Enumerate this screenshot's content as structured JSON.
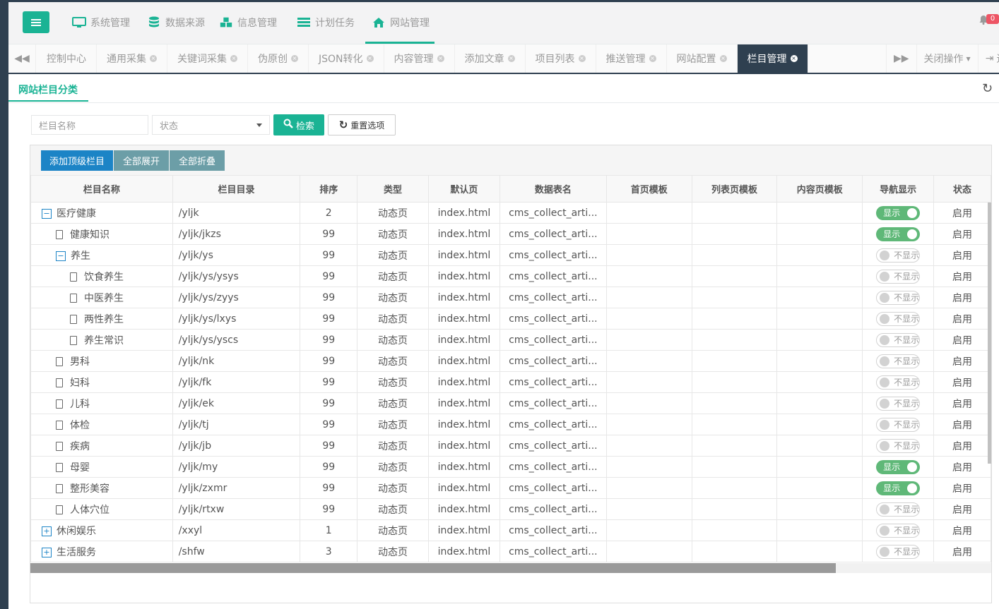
{
  "topnav": {
    "items": [
      {
        "label": "系统管理",
        "icon": "monitor-icon"
      },
      {
        "label": "数据来源",
        "icon": "database-icon"
      },
      {
        "label": "信息管理",
        "icon": "cubes-icon"
      },
      {
        "label": "计划任务",
        "icon": "tasks-icon"
      },
      {
        "label": "网站管理",
        "icon": "home-icon"
      }
    ],
    "active": "网站管理",
    "notification_count": "0"
  },
  "tabs": [
    {
      "label": "控制中心",
      "closable": false
    },
    {
      "label": "通用采集",
      "closable": true
    },
    {
      "label": "关键词采集",
      "closable": true
    },
    {
      "label": "伪原创",
      "closable": true
    },
    {
      "label": "JSON转化",
      "closable": true
    },
    {
      "label": "内容管理",
      "closable": true
    },
    {
      "label": "添加文章",
      "closable": true
    },
    {
      "label": "项目列表",
      "closable": true
    },
    {
      "label": "推送管理",
      "closable": true
    },
    {
      "label": "网站配置",
      "closable": true
    },
    {
      "label": "栏目管理",
      "closable": true,
      "active": true
    }
  ],
  "tab_actions": {
    "close_ops": "关闭操作",
    "exit": "退"
  },
  "page": {
    "title": "网站栏目分类"
  },
  "filters": {
    "name_placeholder": "栏目名称",
    "status_placeholder": "状态",
    "search_label": "检索",
    "reset_label": "重置选项"
  },
  "toolbar": {
    "add_top": "添加顶级栏目",
    "expand_all": "全部展开",
    "collapse_all": "全部折叠"
  },
  "table": {
    "headers": [
      "栏目名称",
      "栏目目录",
      "排序",
      "类型",
      "默认页",
      "数据表名",
      "首页模板",
      "列表页模板",
      "内容页模板",
      "导航显示",
      "状态"
    ],
    "rows": [
      {
        "level": 0,
        "node": "minus",
        "name": "医疗健康",
        "dir": "/yljk",
        "sort": "2",
        "type": "动态页",
        "default": "index.html",
        "table": "cms_collect_arti...",
        "nav": "显示",
        "nav_on": true,
        "status": "启用"
      },
      {
        "level": 1,
        "node": "leaf",
        "name": "健康知识",
        "dir": "/yljk/jkzs",
        "sort": "99",
        "type": "动态页",
        "default": "index.html",
        "table": "cms_collect_arti...",
        "nav": "显示",
        "nav_on": true,
        "status": "启用"
      },
      {
        "level": 1,
        "node": "minus",
        "name": "养生",
        "dir": "/yljk/ys",
        "sort": "99",
        "type": "动态页",
        "default": "index.html",
        "table": "cms_collect_arti...",
        "nav": "不显示",
        "nav_on": false,
        "status": "启用"
      },
      {
        "level": 2,
        "node": "leaf",
        "name": "饮食养生",
        "dir": "/yljk/ys/ysys",
        "sort": "99",
        "type": "动态页",
        "default": "index.html",
        "table": "cms_collect_arti...",
        "nav": "不显示",
        "nav_on": false,
        "status": "启用"
      },
      {
        "level": 2,
        "node": "leaf",
        "name": "中医养生",
        "dir": "/yljk/ys/zyys",
        "sort": "99",
        "type": "动态页",
        "default": "index.html",
        "table": "cms_collect_arti...",
        "nav": "不显示",
        "nav_on": false,
        "status": "启用"
      },
      {
        "level": 2,
        "node": "leaf",
        "name": "两性养生",
        "dir": "/yljk/ys/lxys",
        "sort": "99",
        "type": "动态页",
        "default": "index.html",
        "table": "cms_collect_arti...",
        "nav": "不显示",
        "nav_on": false,
        "status": "启用"
      },
      {
        "level": 2,
        "node": "leaf",
        "name": "养生常识",
        "dir": "/yljk/ys/yscs",
        "sort": "99",
        "type": "动态页",
        "default": "index.html",
        "table": "cms_collect_arti...",
        "nav": "不显示",
        "nav_on": false,
        "status": "启用"
      },
      {
        "level": 1,
        "node": "leaf",
        "name": "男科",
        "dir": "/yljk/nk",
        "sort": "99",
        "type": "动态页",
        "default": "index.html",
        "table": "cms_collect_arti...",
        "nav": "不显示",
        "nav_on": false,
        "status": "启用"
      },
      {
        "level": 1,
        "node": "leaf",
        "name": "妇科",
        "dir": "/yljk/fk",
        "sort": "99",
        "type": "动态页",
        "default": "index.html",
        "table": "cms_collect_arti...",
        "nav": "不显示",
        "nav_on": false,
        "status": "启用"
      },
      {
        "level": 1,
        "node": "leaf",
        "name": "儿科",
        "dir": "/yljk/ek",
        "sort": "99",
        "type": "动态页",
        "default": "index.html",
        "table": "cms_collect_arti...",
        "nav": "不显示",
        "nav_on": false,
        "status": "启用"
      },
      {
        "level": 1,
        "node": "leaf",
        "name": "体检",
        "dir": "/yljk/tj",
        "sort": "99",
        "type": "动态页",
        "default": "index.html",
        "table": "cms_collect_arti...",
        "nav": "不显示",
        "nav_on": false,
        "status": "启用"
      },
      {
        "level": 1,
        "node": "leaf",
        "name": "疾病",
        "dir": "/yljk/jb",
        "sort": "99",
        "type": "动态页",
        "default": "index.html",
        "table": "cms_collect_arti...",
        "nav": "不显示",
        "nav_on": false,
        "status": "启用"
      },
      {
        "level": 1,
        "node": "leaf",
        "name": "母婴",
        "dir": "/yljk/my",
        "sort": "99",
        "type": "动态页",
        "default": "index.html",
        "table": "cms_collect_arti...",
        "nav": "显示",
        "nav_on": true,
        "status": "启用"
      },
      {
        "level": 1,
        "node": "leaf",
        "name": "整形美容",
        "dir": "/yljk/zxmr",
        "sort": "99",
        "type": "动态页",
        "default": "index.html",
        "table": "cms_collect_arti...",
        "nav": "显示",
        "nav_on": true,
        "status": "启用"
      },
      {
        "level": 1,
        "node": "leaf",
        "name": "人体穴位",
        "dir": "/yljk/rtxw",
        "sort": "99",
        "type": "动态页",
        "default": "index.html",
        "table": "cms_collect_arti...",
        "nav": "不显示",
        "nav_on": false,
        "status": "启用"
      },
      {
        "level": 0,
        "node": "plus",
        "name": "休闲娱乐",
        "dir": "/xxyl",
        "sort": "1",
        "type": "动态页",
        "default": "index.html",
        "table": "cms_collect_arti...",
        "nav": "不显示",
        "nav_on": false,
        "status": "启用"
      },
      {
        "level": 0,
        "node": "plus",
        "name": "生活服务",
        "dir": "/shfw",
        "sort": "3",
        "type": "动态页",
        "default": "index.html",
        "table": "cms_collect_arti...",
        "nav": "不显示",
        "nav_on": false,
        "status": "启用"
      }
    ]
  },
  "colors": {
    "accent": "#1ab394",
    "dark": "#2f4050",
    "primary": "#1c84c6",
    "toggle_on": "#5fb878"
  }
}
